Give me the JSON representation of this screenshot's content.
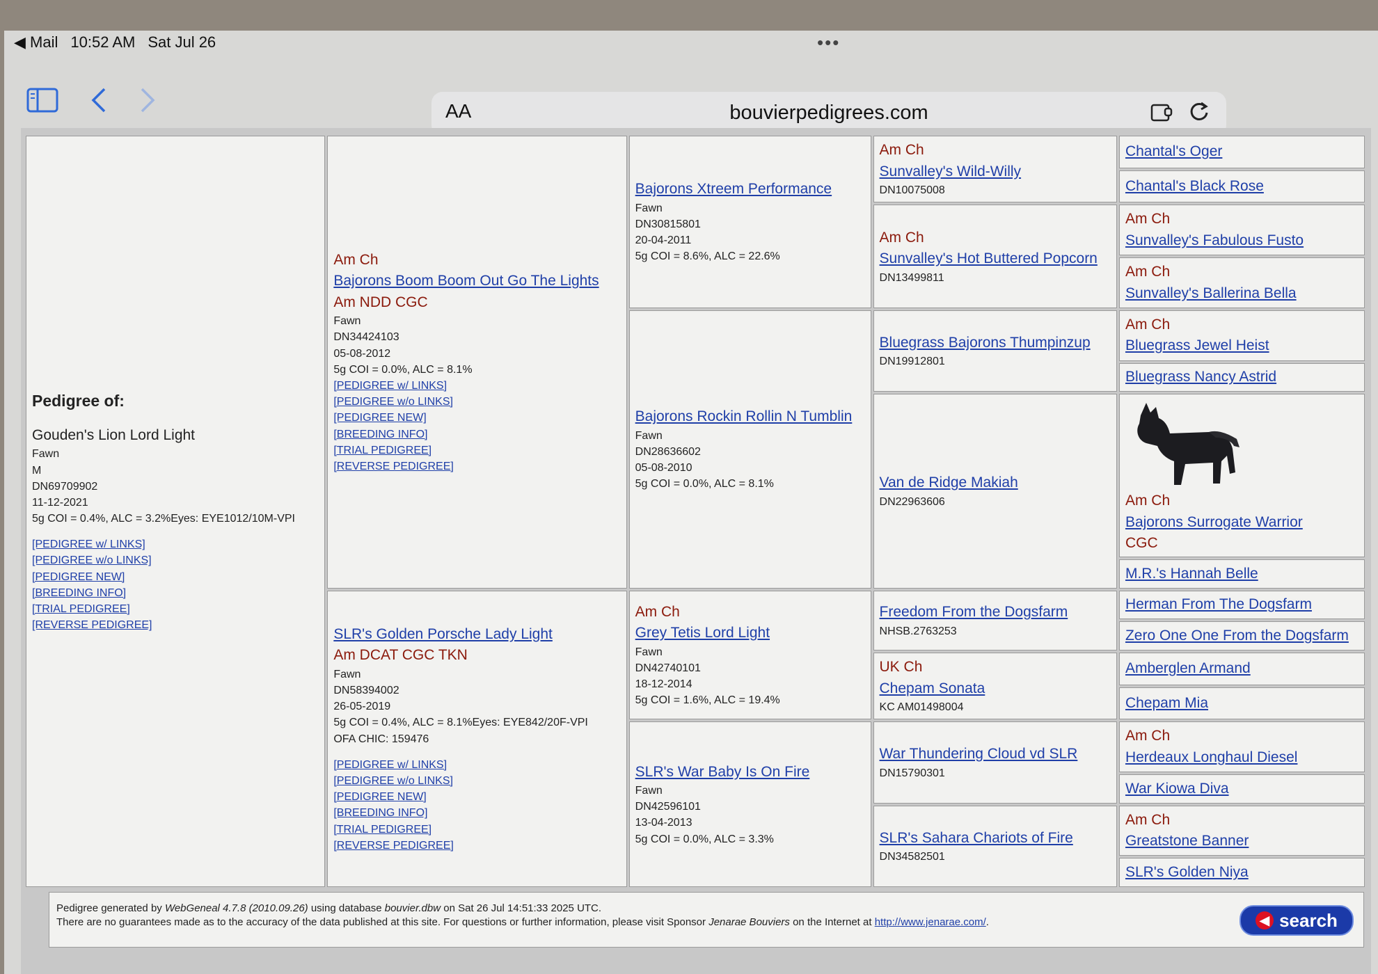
{
  "status": {
    "app": "◀ Mail",
    "time": "10:52 AM",
    "date": "Sat Jul 26",
    "dots": "•••"
  },
  "browser": {
    "aa": "AA",
    "url": "bouvierpedigrees.com"
  },
  "subject": {
    "header": "Pedigree of:",
    "name": "Gouden's Lion Lord Light",
    "color": "Fawn",
    "sex": "M",
    "reg": "DN69709902",
    "dob": "11-12-2021",
    "coi": "5g COI = 0.4%, ALC = 3.2%Eyes: EYE1012/10M-VPI",
    "links": [
      "[PEDIGREE w/ LINKS]",
      "[PEDIGREE w/o LINKS]",
      "[PEDIGREE NEW]",
      "[BREEDING INFO]",
      "[TRIAL PEDIGREE]",
      "[REVERSE PEDIGREE]"
    ]
  },
  "sire": {
    "title": "Am Ch",
    "name": "Bajorons Boom Boom Out Go The Lights",
    "suffix": "Am NDD CGC",
    "color": "Fawn",
    "reg": "DN34424103",
    "dob": "05-08-2012",
    "coi": "5g COI = 0.0%, ALC = 8.1%",
    "links": [
      "[PEDIGREE w/ LINKS]",
      "[PEDIGREE w/o LINKS]",
      "[PEDIGREE NEW]",
      "[BREEDING INFO]",
      "[TRIAL PEDIGREE]",
      "[REVERSE PEDIGREE]"
    ]
  },
  "dam": {
    "name": "SLR's Golden Porsche Lady Light",
    "suffix": "Am DCAT CGC TKN",
    "color": "Fawn",
    "reg": "DN58394002",
    "dob": "26-05-2019",
    "coi": "5g COI = 0.4%, ALC = 8.1%Eyes: EYE842/20F-VPI",
    "extra": "OFA CHIC: 159476",
    "links": [
      "[PEDIGREE w/ LINKS]",
      "[PEDIGREE w/o LINKS]",
      "[PEDIGREE NEW]",
      "[BREEDING INFO]",
      "[TRIAL PEDIGREE]",
      "[REVERSE PEDIGREE]"
    ]
  },
  "gen3": [
    {
      "name": "Bajorons Xtreem Performance",
      "color": "Fawn",
      "reg": "DN30815801",
      "dob": "20-04-2011",
      "coi": "5g COI = 8.6%, ALC = 22.6%"
    },
    {
      "name": "Bajorons Rockin Rollin N Tumblin",
      "color": "Fawn",
      "reg": "DN28636602",
      "dob": "05-08-2010",
      "coi": "5g COI = 0.0%, ALC = 8.1%"
    },
    {
      "title": "Am Ch",
      "name": "Grey Tetis Lord Light",
      "color": "Fawn",
      "reg": "DN42740101",
      "dob": "18-12-2014",
      "coi": "5g COI = 1.6%, ALC = 19.4%"
    },
    {
      "name": "SLR's War Baby Is On Fire",
      "color": "Fawn",
      "reg": "DN42596101",
      "dob": "13-04-2013",
      "coi": "5g COI = 0.0%, ALC = 3.3%"
    }
  ],
  "gen4": [
    {
      "title": "Am Ch",
      "name": "Sunvalley's Wild-Willy",
      "reg": "DN10075008"
    },
    {
      "title": "Am Ch",
      "name": "Sunvalley's Hot Buttered Popcorn",
      "reg": "DN13499811"
    },
    {
      "name": "Bluegrass Bajorons Thumpinzup",
      "reg": "DN19912801"
    },
    {
      "name": "Van de Ridge Makiah",
      "reg": "DN22963606"
    },
    {
      "name": "Freedom From the Dogsfarm",
      "reg": "NHSB.2763253"
    },
    {
      "title": "UK Ch",
      "name": "Chepam Sonata",
      "reg": "KC AM01498004"
    },
    {
      "name": "War Thundering Cloud vd SLR",
      "reg": "DN15790301"
    },
    {
      "name": "SLR's Sahara Chariots of Fire",
      "reg": "DN34582501"
    }
  ],
  "gen5": [
    {
      "name": "Chantal's Oger"
    },
    {
      "name": "Chantal's Black Rose"
    },
    {
      "title": "Am Ch",
      "name": "Sunvalley's Fabulous Fusto"
    },
    {
      "title": "Am Ch",
      "name": "Sunvalley's Ballerina Bella"
    },
    {
      "title": "Am Ch",
      "name": "Bluegrass Jewel Heist"
    },
    {
      "name": "Bluegrass Nancy Astrid"
    },
    {
      "title": "Am Ch",
      "name": "Bajorons Surrogate Warrior",
      "suffix": "CGC"
    },
    {
      "name": "M.R.'s Hannah Belle"
    },
    {
      "name": "Herman From The Dogsfarm"
    },
    {
      "name": "Zero One One From the Dogsfarm"
    },
    {
      "name": "Amberglen Armand"
    },
    {
      "name": "Chepam Mia"
    },
    {
      "title": "Am Ch",
      "name": "Herdeaux Longhaul Diesel"
    },
    {
      "name": "War Kiowa Diva"
    },
    {
      "title": "Am Ch",
      "name": "Greatstone Banner"
    },
    {
      "name": "SLR's Golden Niya"
    }
  ],
  "footer": {
    "l1a": "Pedigree generated by ",
    "l1b": "WebGeneal 4.7.8 (2010.09.26)",
    "l1c": " using database ",
    "l1d": "bouvier.dbw",
    "l1e": " on Sat 26 Jul 14:51:33 2025 UTC.",
    "l2a": "There are no guarantees made as to the accuracy of the data published at this site. For questions or further information, please visit Sponsor ",
    "l2b": "Jenarae Bouviers",
    "l2c": " on the Internet at ",
    "l2link": "http://www.jenarae.com/",
    "l2d": ".",
    "search": "search"
  },
  "colors": {
    "link": "#1f3fa8",
    "title": "#8b1a0c",
    "search_btn": "#1b3aa8"
  }
}
